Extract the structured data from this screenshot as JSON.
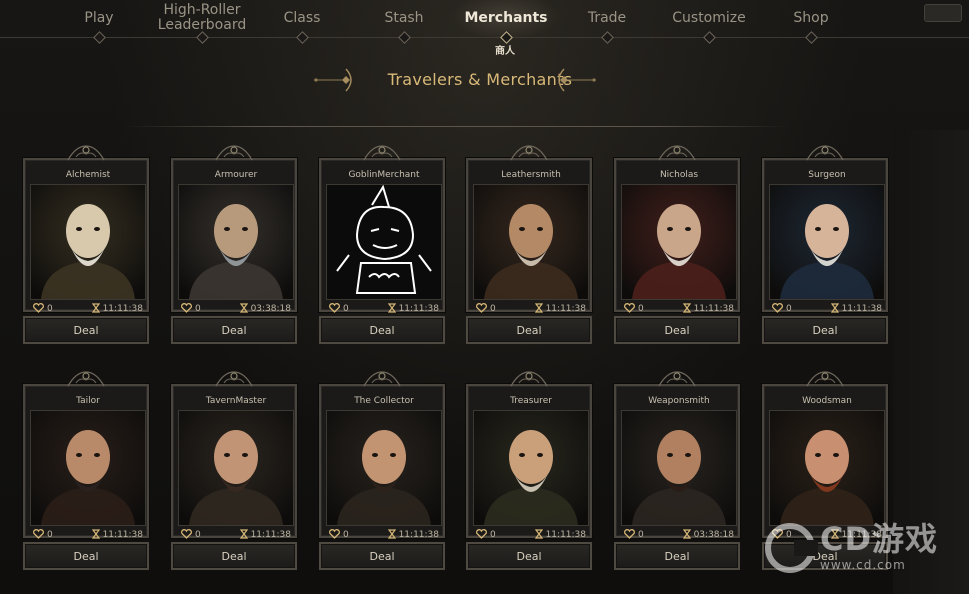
{
  "nav": {
    "items": [
      {
        "label": "Play"
      },
      {
        "label": "High-Roller Leaderboard"
      },
      {
        "label": "Class"
      },
      {
        "label": "Stash"
      },
      {
        "label": "Merchants"
      },
      {
        "label": "Trade"
      },
      {
        "label": "Customize"
      },
      {
        "label": "Shop"
      }
    ],
    "active": "Merchants",
    "active_subtitle": "商人"
  },
  "section": {
    "title": "Travelers & Merchants"
  },
  "merchants": [
    {
      "name": "Alchemist",
      "affinity": "0",
      "timer": "11:11:38",
      "deal": "Deal"
    },
    {
      "name": "Armourer",
      "affinity": "0",
      "timer": "03:38:18",
      "deal": "Deal"
    },
    {
      "name": "GoblinMerchant",
      "affinity": "0",
      "timer": "11:11:38",
      "deal": "Deal"
    },
    {
      "name": "Leathersmith",
      "affinity": "0",
      "timer": "11:11:38",
      "deal": "Deal"
    },
    {
      "name": "Nicholas",
      "affinity": "0",
      "timer": "11:11:38",
      "deal": "Deal"
    },
    {
      "name": "Surgeon",
      "affinity": "0",
      "timer": "11:11:38",
      "deal": "Deal"
    },
    {
      "name": "Tailor",
      "affinity": "0",
      "timer": "11:11:38",
      "deal": "Deal"
    },
    {
      "name": "TavernMaster",
      "affinity": "0",
      "timer": "11:11:38",
      "deal": "Deal"
    },
    {
      "name": "The Collector",
      "affinity": "0",
      "timer": "11:11:38",
      "deal": "Deal"
    },
    {
      "name": "Treasurer",
      "affinity": "0",
      "timer": "11:11:38",
      "deal": "Deal"
    },
    {
      "name": "Weaponsmith",
      "affinity": "0",
      "timer": "03:38:18",
      "deal": "Deal"
    },
    {
      "name": "Woodsman",
      "affinity": "0",
      "timer": "11:11:38",
      "deal": "Deal"
    }
  ],
  "watermark": {
    "logo": "CD游戏",
    "url": "www.cd.com"
  },
  "colors": {
    "accent_gold": "#d8b978",
    "frame": "#4a463f",
    "background": "#131211"
  }
}
